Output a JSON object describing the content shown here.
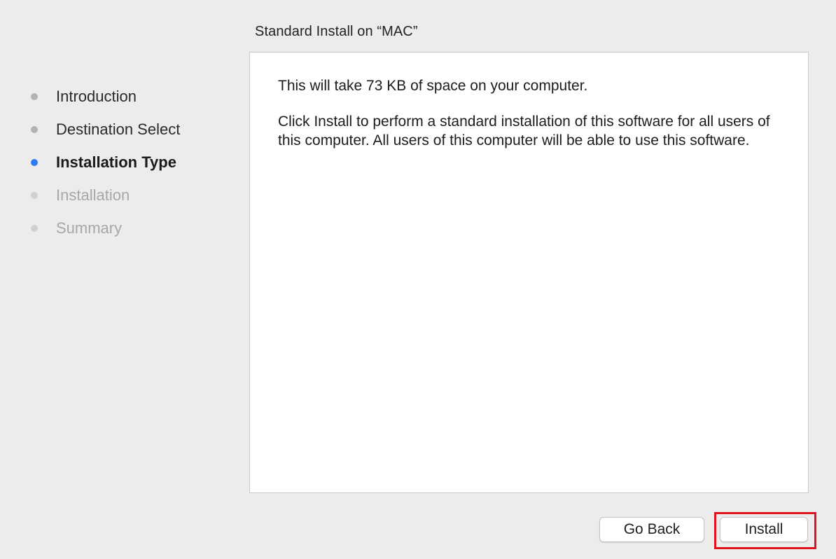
{
  "panel": {
    "title": "Standard Install on “MAC”"
  },
  "steps": [
    {
      "label": "Introduction",
      "state": "done"
    },
    {
      "label": "Destination Select",
      "state": "done"
    },
    {
      "label": "Installation Type",
      "state": "current"
    },
    {
      "label": "Installation",
      "state": "pending"
    },
    {
      "label": "Summary",
      "state": "pending"
    }
  ],
  "content": {
    "space_notice": "This will take 73 KB of space on your computer.",
    "description": "Click Install to perform a standard installation of this software for all users of this computer. All users of this computer will be able to use this software."
  },
  "buttons": {
    "go_back": "Go Back",
    "install": "Install"
  },
  "colors": {
    "current_step_dot": "#2f7cf6",
    "highlight_border": "#e0141e"
  }
}
